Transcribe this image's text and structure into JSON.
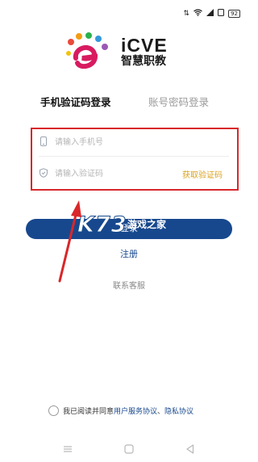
{
  "status_bar": {
    "battery": "92"
  },
  "brand": {
    "name_en": "iCVE",
    "name_cn": "智慧职教"
  },
  "tabs": [
    {
      "label": "手机验证码登录",
      "active": true
    },
    {
      "label": "账号密码登录",
      "active": false
    }
  ],
  "form": {
    "phone_placeholder": "请输入手机号",
    "code_placeholder": "请输入验证码",
    "get_code_label": "获取验证码"
  },
  "login_button": {
    "label": "登录"
  },
  "watermark": {
    "main": "K73",
    "sub": "游戏之家"
  },
  "register_label": "注册",
  "service_label": "联系客服",
  "agreement": {
    "prefix": "我已阅读并同意",
    "user_agreement": "用户服务协议",
    "separator": "、",
    "privacy": "隐私协议"
  },
  "colors": {
    "primary": "#17488e",
    "accent": "#d9a21d",
    "highlight": "#d9272a"
  }
}
